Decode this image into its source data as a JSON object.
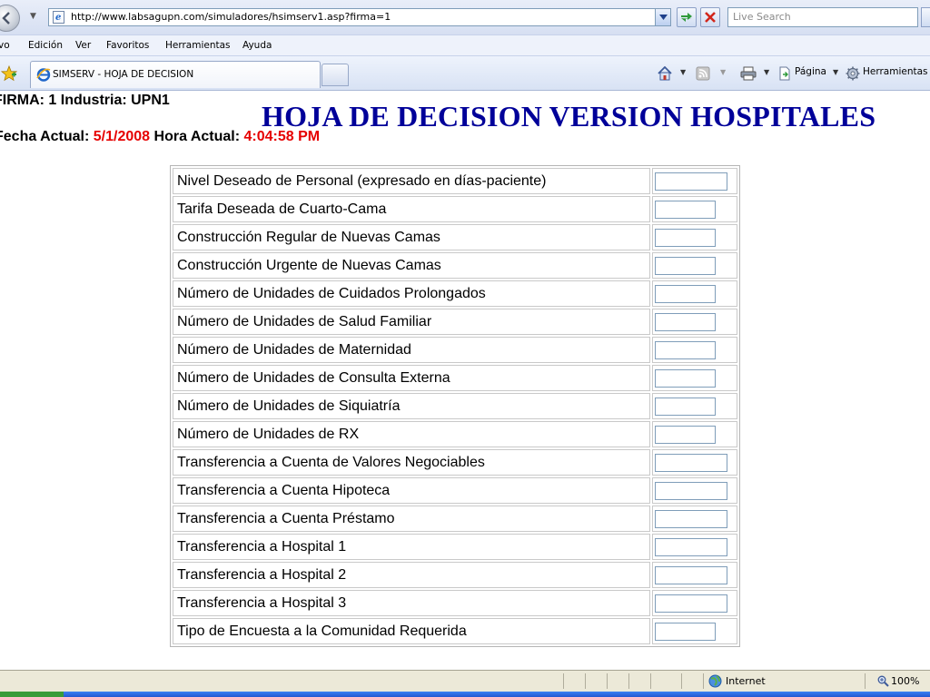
{
  "browser": {
    "address_url": "http://www.labsagupn.com/simuladores/hsimserv1.asp?firma=1",
    "search_placeholder": "Live Search",
    "menu": [
      "vo",
      "Edición",
      "Ver",
      "Favoritos",
      "Herramientas",
      "Ayuda"
    ],
    "tab_title": "SIMSERV - HOJA DE DECISION",
    "cmd_page_label": "Página",
    "cmd_tools_label": "Herramientas",
    "status_zone": "Internet",
    "zoom": "100%"
  },
  "page": {
    "firma_prefix": "FIRMA: 1 Industria: UPN1",
    "date_label": "Fecha Actual:",
    "date_value": "5/1/2008",
    "time_label": "Hora Actual:",
    "time_value": "4:04:58 PM",
    "title": "HOJA DE DECISION VERSION HOSPITALES",
    "colors": {
      "title": "#000099",
      "highlight": "#e60000"
    }
  },
  "decision_rows": [
    "Nivel Deseado de Personal (expresado en días-paciente)",
    "Tarifa Deseada de Cuarto-Cama",
    "Construcción Regular de Nuevas Camas",
    "Construcción Urgente de Nuevas Camas",
    "Número de Unidades de Cuidados Prolongados",
    "Número de Unidades de Salud Familiar",
    "Número de Unidades de Maternidad",
    "Número de Unidades de Consulta Externa",
    "Número de Unidades de Siquiatría",
    "Número de Unidades de RX",
    "Transferencia a Cuenta de Valores Negociables",
    "Transferencia a Cuenta Hipoteca",
    "Transferencia a Cuenta Préstamo",
    "Transferencia a Hospital 1",
    "Transferencia a Hospital 2",
    "Transferencia a Hospital 3",
    "Tipo de Encuesta a la Comunidad Requerida"
  ]
}
